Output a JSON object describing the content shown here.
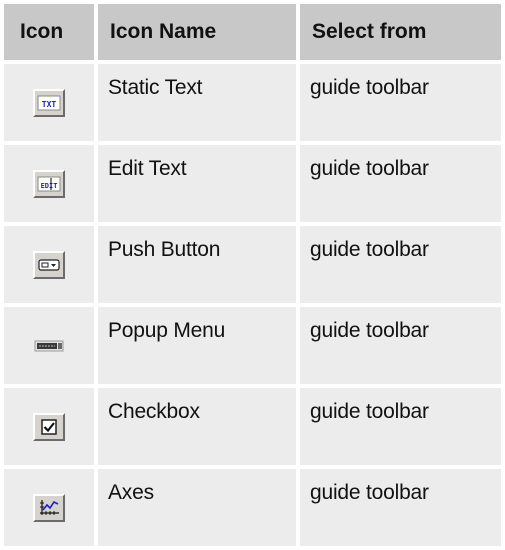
{
  "table": {
    "headers": {
      "icon": "Icon",
      "name": "Icon Name",
      "select": "Select from"
    },
    "rows": [
      {
        "icon": "static-text-icon",
        "name": "Static Text",
        "select": "guide toolbar",
        "glyph": "TXT"
      },
      {
        "icon": "edit-text-icon",
        "name": "Edit Text",
        "select": "guide toolbar",
        "glyph": "EDIT"
      },
      {
        "icon": "push-button-icon",
        "name": "Push Button",
        "select": "guide toolbar"
      },
      {
        "icon": "popup-menu-icon",
        "name": "Popup Menu",
        "select": "guide toolbar"
      },
      {
        "icon": "checkbox-icon",
        "name": "Checkbox",
        "select": "guide toolbar"
      },
      {
        "icon": "axes-icon",
        "name": "Axes",
        "select": "guide toolbar"
      }
    ]
  },
  "colors": {
    "header_bg": "#c8c8c8",
    "cell_bg": "#ececec",
    "icon_blue": "#1a22c8",
    "icon_face": "#d6d3ce"
  }
}
